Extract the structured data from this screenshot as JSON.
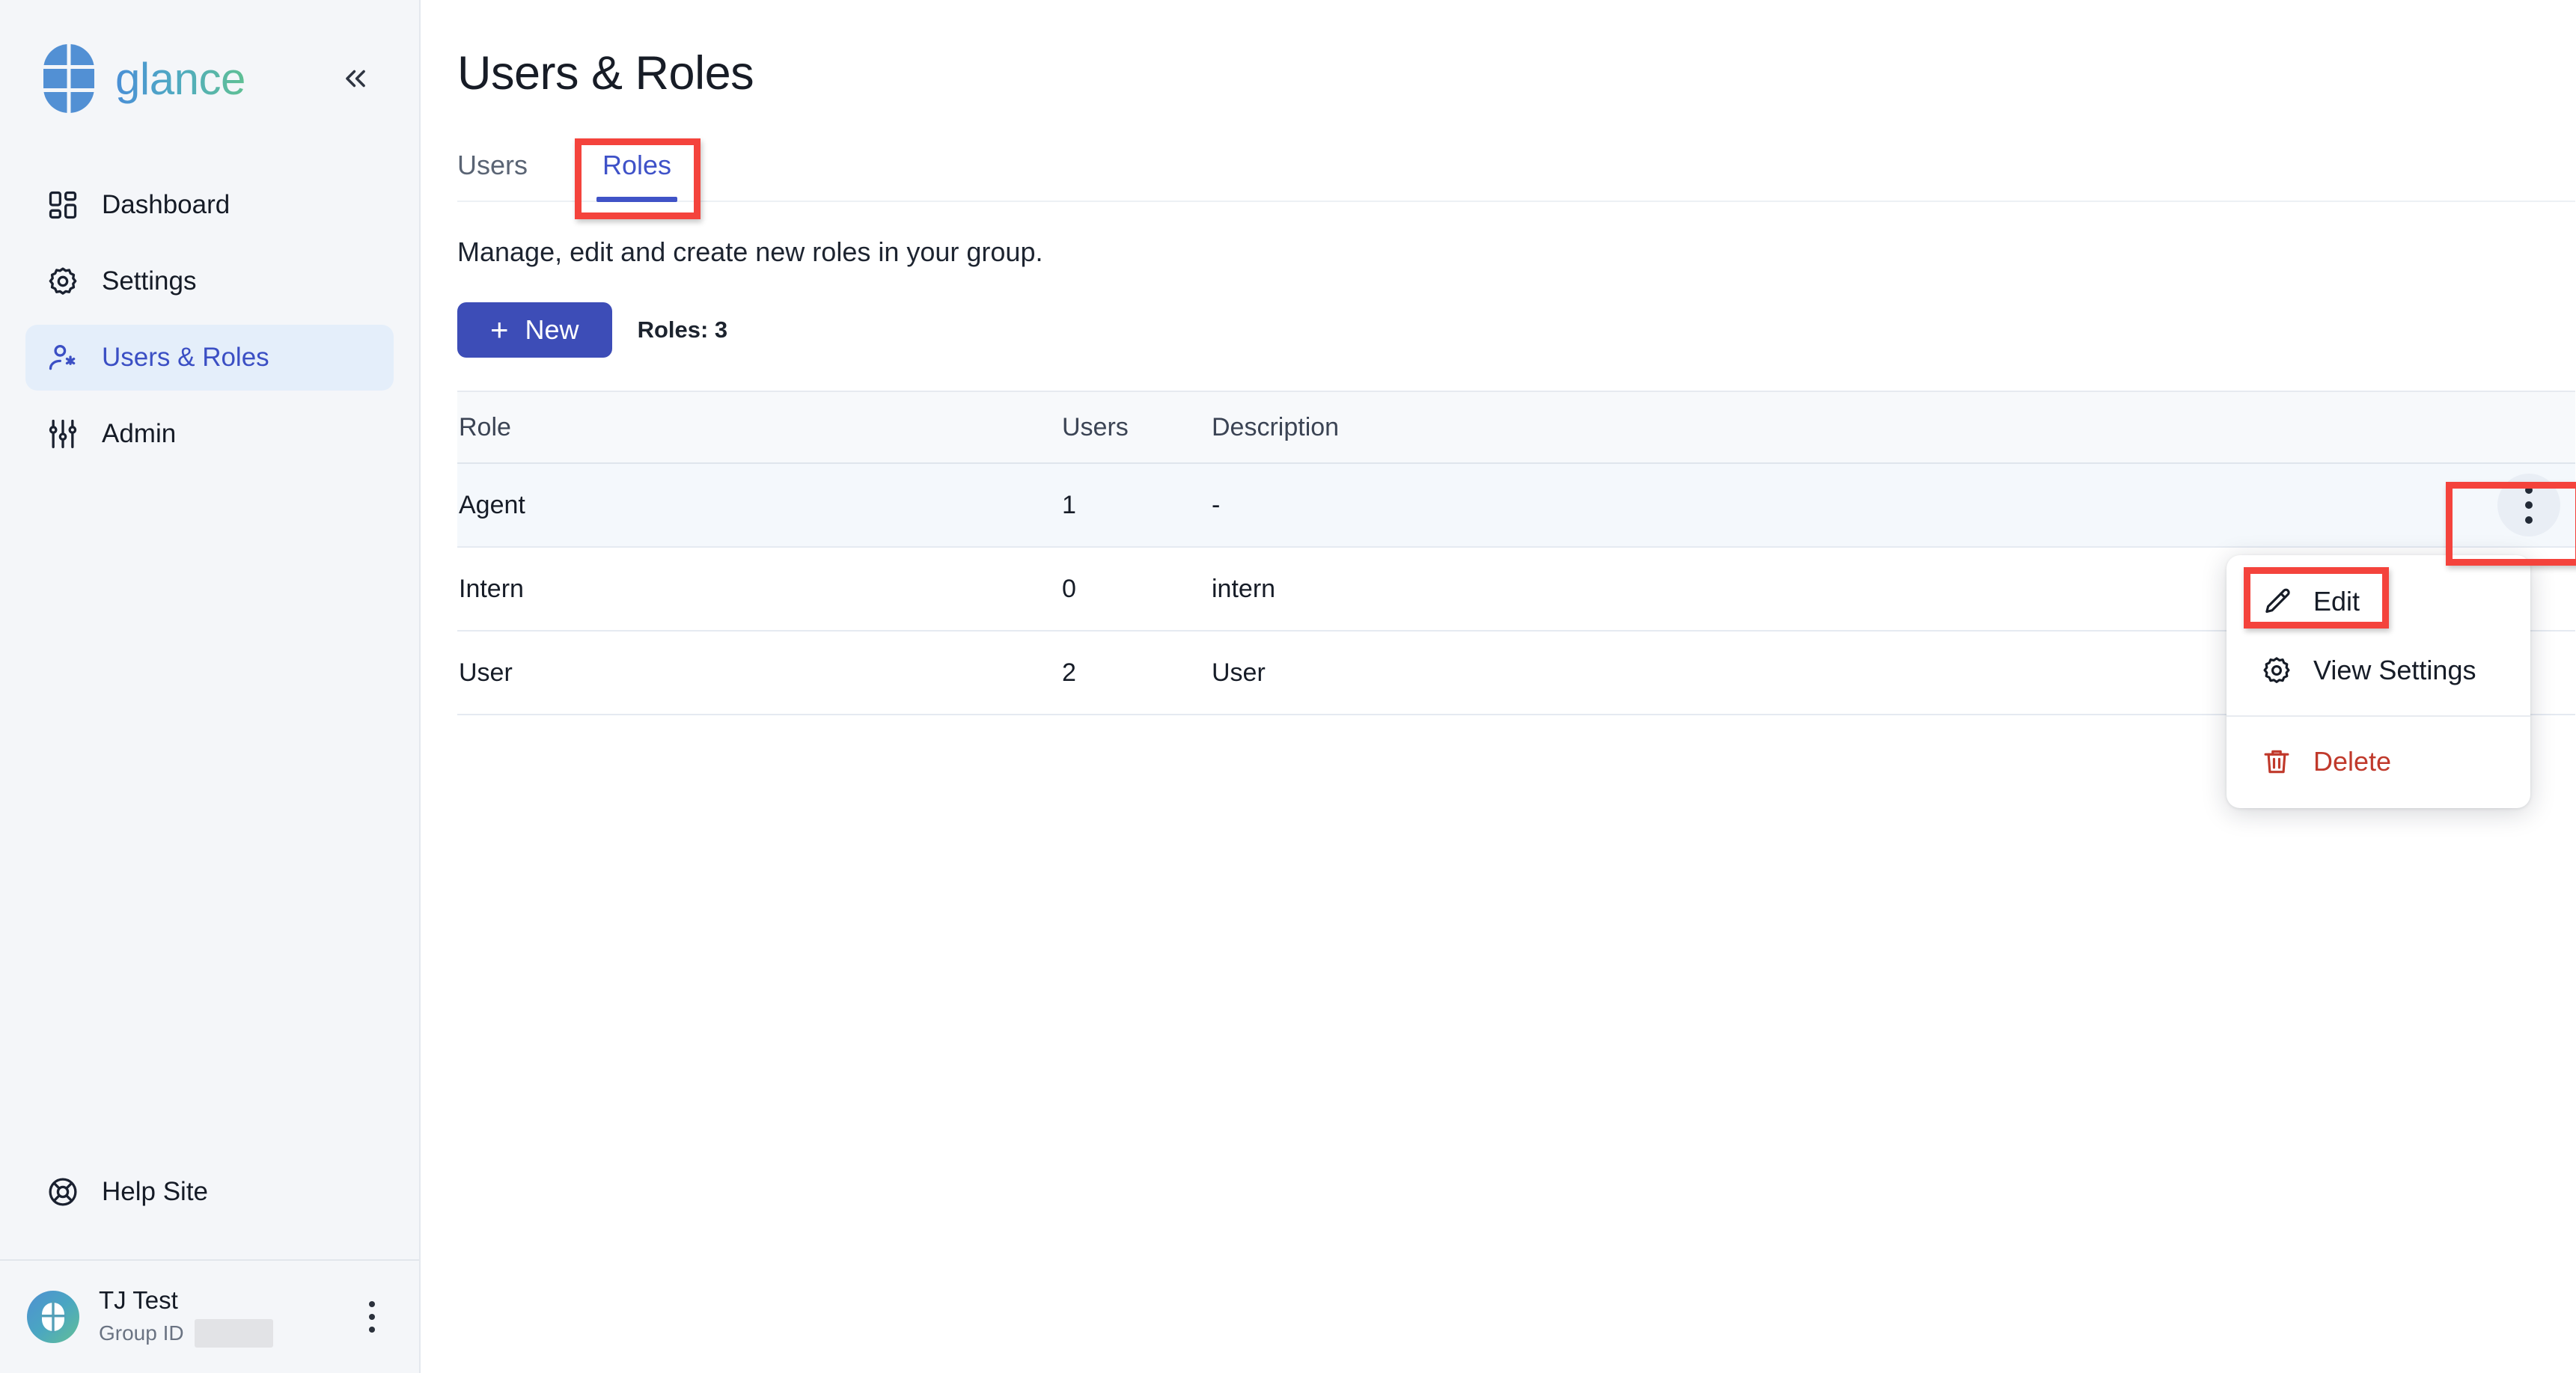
{
  "sidebar": {
    "brand": {
      "name": "glance",
      "logo_icon": "glance-logo-icon"
    },
    "collapse_icon": "chevron-double-left-icon",
    "items": [
      {
        "label": "Dashboard",
        "icon": "dashboard-grid-icon",
        "active": false
      },
      {
        "label": "Settings",
        "icon": "gear-icon",
        "active": false
      },
      {
        "label": "Users & Roles",
        "icon": "user-gear-icon",
        "active": true
      },
      {
        "label": "Admin",
        "icon": "sliders-icon",
        "active": false
      }
    ],
    "help": {
      "label": "Help Site",
      "icon": "lifebuoy-icon"
    },
    "profile": {
      "name": "TJ Test",
      "group_id_label": "Group ID",
      "group_id_value": "",
      "avatar_icon": "glance-avatar-icon",
      "menu_icon": "more-vertical-icon"
    }
  },
  "main": {
    "title": "Users & Roles",
    "tabs": [
      {
        "label": "Users",
        "active": false
      },
      {
        "label": "Roles",
        "active": true
      }
    ],
    "subtitle": "Manage, edit and create new roles in your group.",
    "toolbar": {
      "new_label": "New",
      "new_plus_icon": "plus-icon",
      "roles_count_label": "Roles: 3"
    },
    "table": {
      "columns": [
        "Role",
        "Users",
        "Description"
      ],
      "rows": [
        {
          "role": "Agent",
          "users": "1",
          "description": "-",
          "hovered": true,
          "menu_icon": "more-vertical-icon"
        },
        {
          "role": "Intern",
          "users": "0",
          "description": "intern",
          "hovered": false,
          "menu_icon": "more-vertical-icon"
        },
        {
          "role": "User",
          "users": "2",
          "description": "User",
          "hovered": false,
          "menu_icon": "more-vertical-icon"
        }
      ]
    },
    "context_menu": {
      "items": [
        {
          "label": "Edit",
          "icon": "pencil-icon",
          "danger": false
        },
        {
          "label": "View Settings",
          "icon": "gear-icon",
          "danger": false
        },
        {
          "label": "Delete",
          "icon": "trash-icon",
          "danger": true
        }
      ]
    }
  },
  "colors": {
    "accent_indigo": "#3d4db7",
    "tab_active": "#3f52c8",
    "sidebar_bg": "#f4f6f9",
    "sidebar_active_bg": "#e4eefa",
    "row_hover": "#f4f8fc",
    "danger_red": "#c0392b",
    "annotation_red": "#f4433c"
  }
}
